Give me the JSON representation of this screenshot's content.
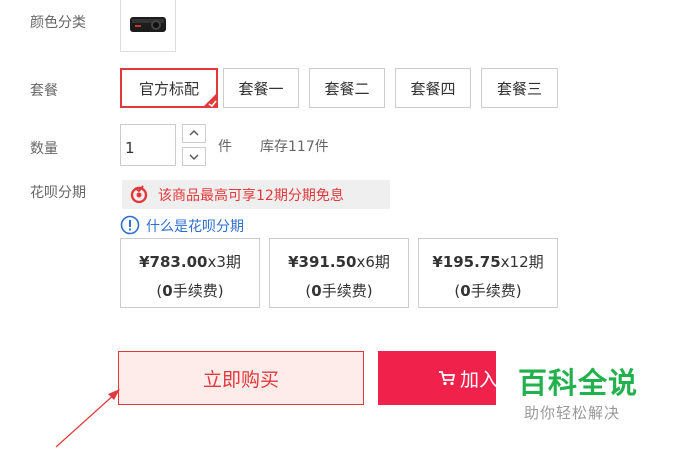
{
  "labels": {
    "color": "颜色分类",
    "package": "套餐",
    "quantity": "数量",
    "huabei": "花呗分期"
  },
  "packages": [
    "官方标配",
    "套餐一",
    "套餐二",
    "套餐四",
    "套餐三"
  ],
  "selected_package": "官方标配",
  "quantity": {
    "value": "1",
    "unit": "件",
    "stock": "库存117件"
  },
  "installment": {
    "promo": "该商品最高可享12期分期免息",
    "help_link": "什么是花呗分期",
    "plans": [
      {
        "amount": "¥783.00",
        "term": "x3期",
        "fee_prefix": "(",
        "fee_value": "0",
        "fee_suffix": "手续费)"
      },
      {
        "amount": "¥391.50",
        "term": "x6期",
        "fee_prefix": "(",
        "fee_value": "0",
        "fee_suffix": "手续费)"
      },
      {
        "amount": "¥195.75",
        "term": "x12期",
        "fee_prefix": "(",
        "fee_value": "0",
        "fee_suffix": "手续费)"
      }
    ]
  },
  "buttons": {
    "buy_now": "立即购买",
    "add_to_cart": "加入"
  },
  "watermark": {
    "title": "百科全说",
    "subtitle": "助你轻松解决"
  },
  "colors": {
    "accent_red": "#e4393c",
    "cart_red": "#f0214a",
    "link_blue": "#2d6fd0",
    "watermark_green": "#22b14c"
  }
}
